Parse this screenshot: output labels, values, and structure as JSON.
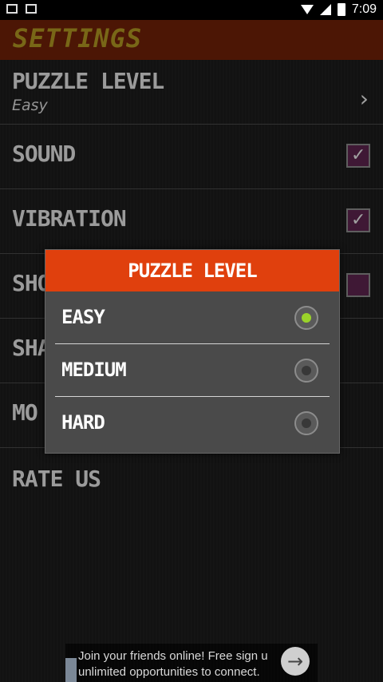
{
  "status_bar": {
    "time": "7:09"
  },
  "header": {
    "title": "SETTINGS"
  },
  "settings": {
    "puzzle_level": {
      "label": "PUZZLE LEVEL",
      "value": "Easy"
    },
    "sound": {
      "label": "SOUND",
      "checked": true
    },
    "vibration": {
      "label": "VIBRATION",
      "checked": true
    },
    "row4_label": "SHO",
    "row5_label": "SHA",
    "row6_label": "MO",
    "rate_us": {
      "label": "RATE US"
    }
  },
  "dialog": {
    "title": "PUZZLE LEVEL",
    "options": [
      {
        "label": "EASY",
        "selected": true
      },
      {
        "label": "MEDIUM",
        "selected": false
      },
      {
        "label": "HARD",
        "selected": false
      }
    ]
  },
  "ad": {
    "text_line1": "Join your friends online! Free sign u",
    "text_line2": "unlimited opportunities to connect."
  }
}
